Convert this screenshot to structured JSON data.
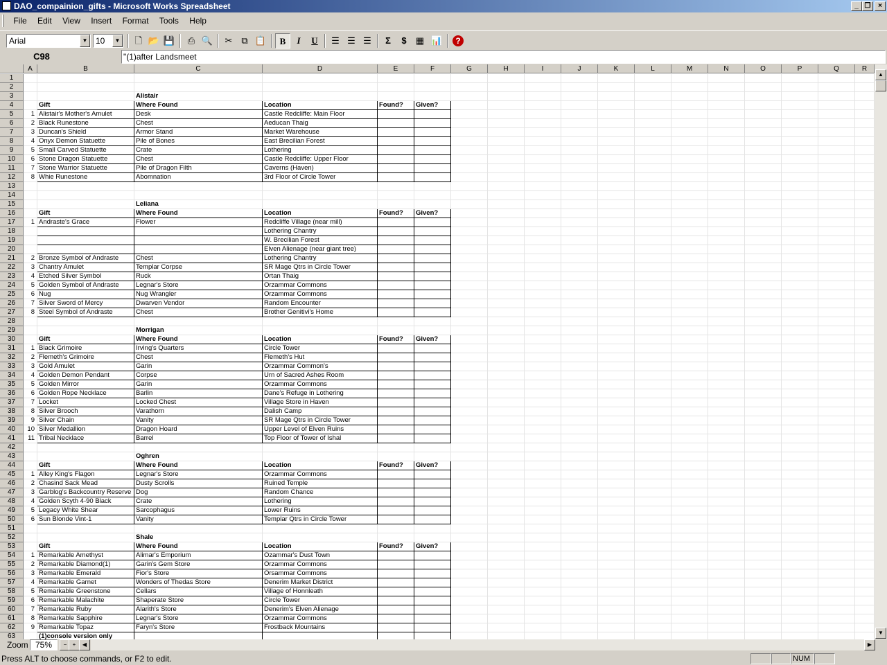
{
  "window": {
    "title": "DAO_compainion_gifts - Microsoft Works Spreadsheet"
  },
  "menu": [
    "File",
    "Edit",
    "View",
    "Insert",
    "Format",
    "Tools",
    "Help"
  ],
  "toolbar": {
    "font": "Arial",
    "size": "10"
  },
  "formula": {
    "cell": "C98",
    "value": "\"(1)after Landsmeet"
  },
  "columns": [
    "A",
    "B",
    "C",
    "D",
    "E",
    "F",
    "G",
    "H",
    "I",
    "J",
    "K",
    "L",
    "M",
    "N",
    "O",
    "P",
    "Q",
    "R"
  ],
  "rows": [
    {
      "n": "1"
    },
    {
      "n": "2"
    },
    {
      "n": "3",
      "C": "Alistair"
    },
    {
      "n": "4",
      "B": "Gift",
      "C": "Where Found",
      "D": "Location",
      "E": "Found?",
      "F": "Given?",
      "h": 1
    },
    {
      "n": "5",
      "A": "1",
      "B": "Alistair's Mother's Amulet",
      "C": "Desk",
      "D": "Castle Redcliffe: Main Floor",
      "t": 1
    },
    {
      "n": "6",
      "A": "2",
      "B": "Black Runestone",
      "C": "Chest",
      "D": "Aeducan Thaig",
      "t": 1
    },
    {
      "n": "7",
      "A": "3",
      "B": "Duncan's Shield",
      "C": "Armor Stand",
      "D": "Market Warehouse",
      "t": 1
    },
    {
      "n": "8",
      "A": "4",
      "B": "Onyx Demon Statuette",
      "C": "Pile of Bones",
      "D": "East Brecilian Forest",
      "t": 1
    },
    {
      "n": "9",
      "A": "5",
      "B": "Small Carved Statuette",
      "C": "Crate",
      "D": "Lothering",
      "t": 1
    },
    {
      "n": "10",
      "A": "6",
      "B": "Stone Dragon Statuette",
      "C": "Chest",
      "D": "Castle Redcliffe: Upper Floor",
      "t": 1
    },
    {
      "n": "11",
      "A": "7",
      "B": "Stone Warrior Statuette",
      "C": "Pile of Dragon Filth",
      "D": "Caverns (Haven)",
      "t": 1
    },
    {
      "n": "12",
      "A": "8",
      "B": "Whie Runestone",
      "C": "Abomnation",
      "D": "3rd Floor of Circle Tower",
      "t": 1
    },
    {
      "n": "13"
    },
    {
      "n": "14"
    },
    {
      "n": "15",
      "C": "Leliana"
    },
    {
      "n": "16",
      "B": "Gift",
      "C": "Where Found",
      "D": "Location",
      "E": "Found?",
      "F": "Given?",
      "h": 1
    },
    {
      "n": "17",
      "A": "1",
      "B": "Andraste's Grace",
      "C": "Flower",
      "D": "Redcliffe Village (near mill)",
      "t": 1
    },
    {
      "n": "18",
      "D": "Lothering Chantry",
      "t": 1
    },
    {
      "n": "19",
      "D": "W. Brecilian Forest",
      "t": 1
    },
    {
      "n": "20",
      "D": "Elven Alienage (near giant tree)",
      "t": 1
    },
    {
      "n": "21",
      "A": "2",
      "B": "Bronze Symbol of Andraste",
      "C": "Chest",
      "D": "Lothering Chantry",
      "t": 1
    },
    {
      "n": "22",
      "A": "3",
      "B": "Chantry Amulet",
      "C": "Templar Corpse",
      "D": "SR Mage Qtrs in Circle Tower",
      "t": 1
    },
    {
      "n": "23",
      "A": "4",
      "B": "Etched Silver Symbol",
      "C": "Ruck",
      "D": "Ortan Thaig",
      "t": 1
    },
    {
      "n": "24",
      "A": "5",
      "B": "Golden Symbol of Andraste",
      "C": "Legnar's Store",
      "D": "Orzammar Commons",
      "t": 1
    },
    {
      "n": "25",
      "A": "6",
      "B": "Nug",
      "C": "Nug Wrangler",
      "D": "Orzammar Commons",
      "t": 1
    },
    {
      "n": "26",
      "A": "7",
      "B": "Silver Sword of Mercy",
      "C": "Dwarven Vendor",
      "D": "Random Encounter",
      "t": 1
    },
    {
      "n": "27",
      "A": "8",
      "B": "Steel Symbol of Andraste",
      "C": "Chest",
      "D": "Brother Genitivi's Home",
      "t": 1
    },
    {
      "n": "28"
    },
    {
      "n": "29",
      "C": "Morrigan"
    },
    {
      "n": "30",
      "B": "Gift",
      "C": "Where Found",
      "D": "Location",
      "E": "Found?",
      "F": "Given?",
      "h": 1
    },
    {
      "n": "31",
      "A": "1",
      "B": "Black Grimoire",
      "C": "Irving's Quarters",
      "D": "Circle Tower",
      "t": 1
    },
    {
      "n": "32",
      "A": "2",
      "B": "Flemeth's Grimoire",
      "C": "Chest",
      "D": "Flemeth's Hut",
      "t": 1
    },
    {
      "n": "33",
      "A": "3",
      "B": "Gold Amulet",
      "C": "Garin",
      "D": "Orzammar Common's",
      "t": 1
    },
    {
      "n": "34",
      "A": "4",
      "B": "Golden Demon Pendant",
      "C": "Corpse",
      "D": "Urn of Sacred Ashes Room",
      "t": 1
    },
    {
      "n": "35",
      "A": "5",
      "B": "Golden Mirror",
      "C": "Garin",
      "D": "Orzammar Commons",
      "t": 1
    },
    {
      "n": "36",
      "A": "6",
      "B": "Golden Rope Necklace",
      "C": "Barlin",
      "D": "Dane's Refuge in Lothering",
      "t": 1
    },
    {
      "n": "37",
      "A": "7",
      "B": "Locket",
      "C": "Locked Chest",
      "D": "Village Store in Haven",
      "t": 1
    },
    {
      "n": "38",
      "A": "8",
      "B": "Silver Brooch",
      "C": "Varathorn",
      "D": "Dalish Camp",
      "t": 1
    },
    {
      "n": "39",
      "A": "9",
      "B": "Silver Chain",
      "C": "Vanity",
      "D": "SR Mage Qtrs in Circle Tower",
      "t": 1
    },
    {
      "n": "40",
      "A": "10",
      "B": "Silver Medallion",
      "C": "Dragon Hoard",
      "D": "Upper Level of Elven Ruins",
      "t": 1
    },
    {
      "n": "41",
      "A": "11",
      "B": "Tribal Necklace",
      "C": "Barrel",
      "D": "Top Floor of Tower of Ishal",
      "t": 1
    },
    {
      "n": "42"
    },
    {
      "n": "43",
      "C": "Oghren"
    },
    {
      "n": "44",
      "B": "Gift",
      "C": "Where Found",
      "D": "Location",
      "E": "Found?",
      "F": "Given?",
      "h": 1
    },
    {
      "n": "45",
      "A": "1",
      "B": "Alley King's Flagon",
      "C": "Legnar's Store",
      "D": "Orzammar Commons",
      "t": 1
    },
    {
      "n": "46",
      "A": "2",
      "B": "Chasind Sack Mead",
      "C": "Dusty Scrolls",
      "D": "Ruined Temple",
      "t": 1
    },
    {
      "n": "47",
      "A": "3",
      "B": "Garblog's Backcountry Reserve",
      "C": "Dog",
      "D": "Random Chance",
      "t": 1
    },
    {
      "n": "48",
      "A": "4",
      "B": "Golden Scyth 4-90 Black",
      "C": "Crate",
      "D": "Lothering",
      "t": 1
    },
    {
      "n": "49",
      "A": "5",
      "B": "Legacy White Shear",
      "C": "Sarcophagus",
      "D": "Lower Ruins",
      "t": 1
    },
    {
      "n": "50",
      "A": "6",
      "B": "Sun Blonde Vint-1",
      "C": "Vanity",
      "D": "Templar Qtrs in Circle Tower",
      "t": 1
    },
    {
      "n": "51"
    },
    {
      "n": "52",
      "C": "Shale"
    },
    {
      "n": "53",
      "B": "Gift",
      "C": "Where Found",
      "D": "Location",
      "E": "Found?",
      "F": "Given?",
      "h": 1
    },
    {
      "n": "54",
      "A": "1",
      "B": "Remarkable Amethyst",
      "C": "Alimar's Emporium",
      "D": "Ozammar's Dust Town",
      "t": 1
    },
    {
      "n": "55",
      "A": "2",
      "B": "Remarkable Diamond(1)",
      "C": "Garin's Gem Store",
      "D": "Orzammar Commons",
      "t": 1
    },
    {
      "n": "56",
      "A": "3",
      "B": "Remarkable Emerald",
      "C": "Fior's Store",
      "D": "Orsammar Commons",
      "t": 1
    },
    {
      "n": "57",
      "A": "4",
      "B": "Remarkable Garnet",
      "C": "Wonders of Thedas Store",
      "D": "Denerim Market District",
      "t": 1
    },
    {
      "n": "58",
      "A": "5",
      "B": "Remarkable Greenstone",
      "C": "Cellars",
      "D": "Village of Honnleath",
      "t": 1
    },
    {
      "n": "59",
      "A": "6",
      "B": "Remarkable Malachite",
      "C": "Shaperate Store",
      "D": "Circle Tower",
      "t": 1
    },
    {
      "n": "60",
      "A": "7",
      "B": "Remarkable Ruby",
      "C": "Alarith's Store",
      "D": "Denerim's Elven Alienage",
      "t": 1
    },
    {
      "n": "61",
      "A": "8",
      "B": "Remarkable Sapphire",
      "C": "Legnar's Store",
      "D": "Orzammar Commons",
      "t": 1
    },
    {
      "n": "62",
      "A": "9",
      "B": "Remarkable Topaz",
      "C": "Faryn's Store",
      "D": "Frostback Mountains",
      "t": 1
    },
    {
      "n": "63",
      "B": "(1)console version only",
      "t": 1,
      "bb": 1
    }
  ],
  "zoom": {
    "label": "Zoom",
    "value": "75%"
  },
  "status": {
    "text": "Press ALT to choose commands, or F2 to edit.",
    "num": "NUM"
  }
}
